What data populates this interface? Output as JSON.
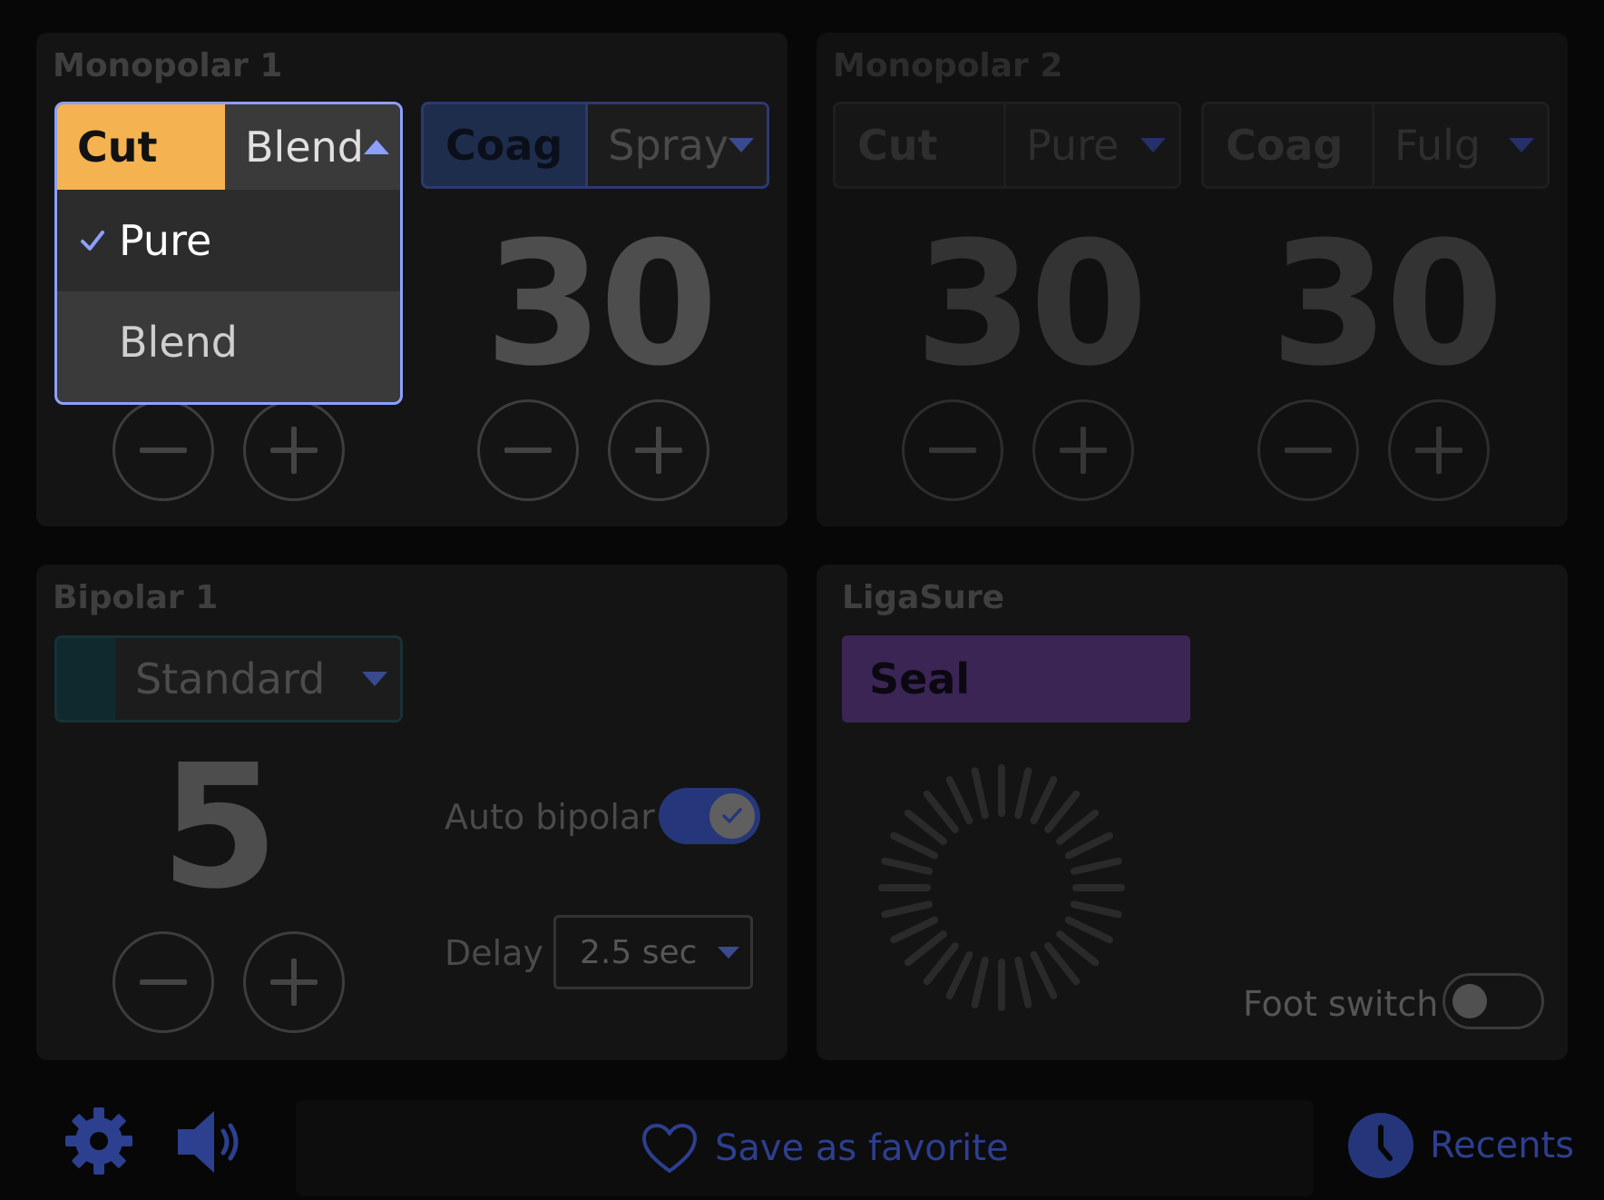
{
  "colors": {
    "background": "#070707",
    "panel": "#141414",
    "cut_accent": "#f4b350",
    "coag_accent": "#1f2d4d",
    "bipolar_accent": "#0f2a2e",
    "ligasure_accent": "#3b2555",
    "active_outline": "#8ea0ff",
    "icon_blue": "#2d3f8f"
  },
  "monopolar1": {
    "title": "Monopolar 1",
    "cut": {
      "label": "Cut",
      "selected_mode": "Blend",
      "dropdown_open": true,
      "options": [
        {
          "label": "Pure",
          "checked": true
        },
        {
          "label": "Blend",
          "checked": false
        }
      ]
    },
    "coag": {
      "label": "Coag",
      "selected_mode": "Spray",
      "value": "30"
    }
  },
  "monopolar2": {
    "title": "Monopolar 2",
    "cut": {
      "label": "Cut",
      "selected_mode": "Pure",
      "value": "30"
    },
    "coag": {
      "label": "Coag",
      "selected_mode": "Fulg",
      "value": "30"
    }
  },
  "bipolar1": {
    "title": "Bipolar 1",
    "mode": "Standard",
    "value": "5",
    "auto_bipolar_label": "Auto bipolar",
    "auto_bipolar_on": true,
    "delay_label": "Delay",
    "delay_value": "2.5 sec"
  },
  "ligasure": {
    "title": "LigaSure",
    "mode": "Seal",
    "foot_switch_label": "Foot switch",
    "foot_switch_on": false,
    "spinner_icon": "loading-spinner-icon"
  },
  "footer": {
    "settings_icon": "gear-icon",
    "volume_icon": "speaker-icon",
    "favorite_label": "Save as favorite",
    "favorite_icon": "heart-icon",
    "recents_label": "Recents",
    "recents_icon": "clock-icon"
  }
}
